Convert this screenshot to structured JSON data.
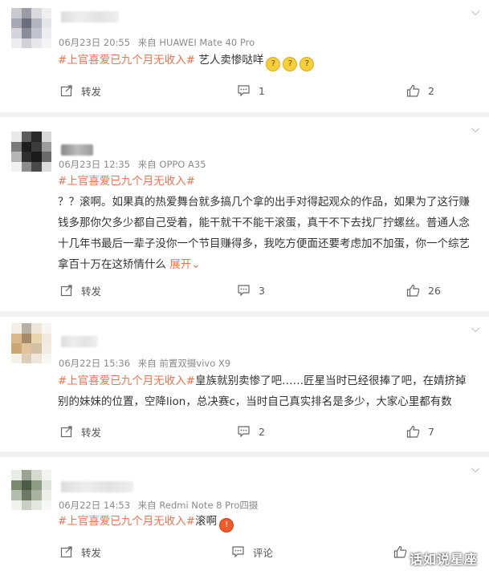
{
  "posts": [
    {
      "name_blurred": "",
      "date": "06月23日 20:55",
      "source": "来自 HUAWEI Mate 40 Pro",
      "tag": "#上官喜爱已九个月无收入#",
      "text": " 艺人卖惨哒咩",
      "emojis": [
        "🤔",
        "🤔",
        "🤔"
      ],
      "repost_label": "转发",
      "comment_count": "1",
      "like_count": "2"
    },
    {
      "name_blurred": "",
      "date": "06月23日 12:35",
      "source": "来自 OPPO A35",
      "tag": "#上官喜爱已九个月无收入#",
      "text": "？？滚啊。如果真的热爱舞台就多搞几个拿的出手对得起观众的作品，如果为了这行赚钱多那你欠多少都自己受着，能干就干不能干滚蛋，真干不下去找厂拧螺丝。普通人念十几年书最后一辈子没你一个节目赚得多，我吃方便面还要考虑加不加蛋，你一个综艺拿百十万在这矫情什么",
      "expand_label": "展开",
      "repost_label": "转发",
      "comment_count": "3",
      "like_count": "26"
    },
    {
      "name_blurred": "",
      "date": "06月22日 15:36",
      "source": "来自 前置双摄vivo X9",
      "tag": "#上官喜爱已九个月无收入#",
      "text": "皇族就别卖惨了吧……匠星当时已经很捧了吧，在婧挤掉别的妹妹的位置，空降lion，总决赛c，当时自己真实排名是多少，大家心里都有数",
      "repost_label": "转发",
      "comment_count": "2",
      "like_count": "7"
    },
    {
      "name_blurred": "",
      "date": "06月22日 14:53",
      "source": "来自 Redmi Note 8 Pro四摄",
      "tag": "#上官喜爱已九个月无收入#",
      "text": "滚啊",
      "emojis": [
        "😡"
      ],
      "repost_label": "转发",
      "comment_label": "评论",
      "like_count": ""
    }
  ],
  "watermark": "话如说星座",
  "colors": {
    "tag": "#eb7350",
    "meta": "#8a8a8a",
    "background": "#f2f2f2"
  }
}
